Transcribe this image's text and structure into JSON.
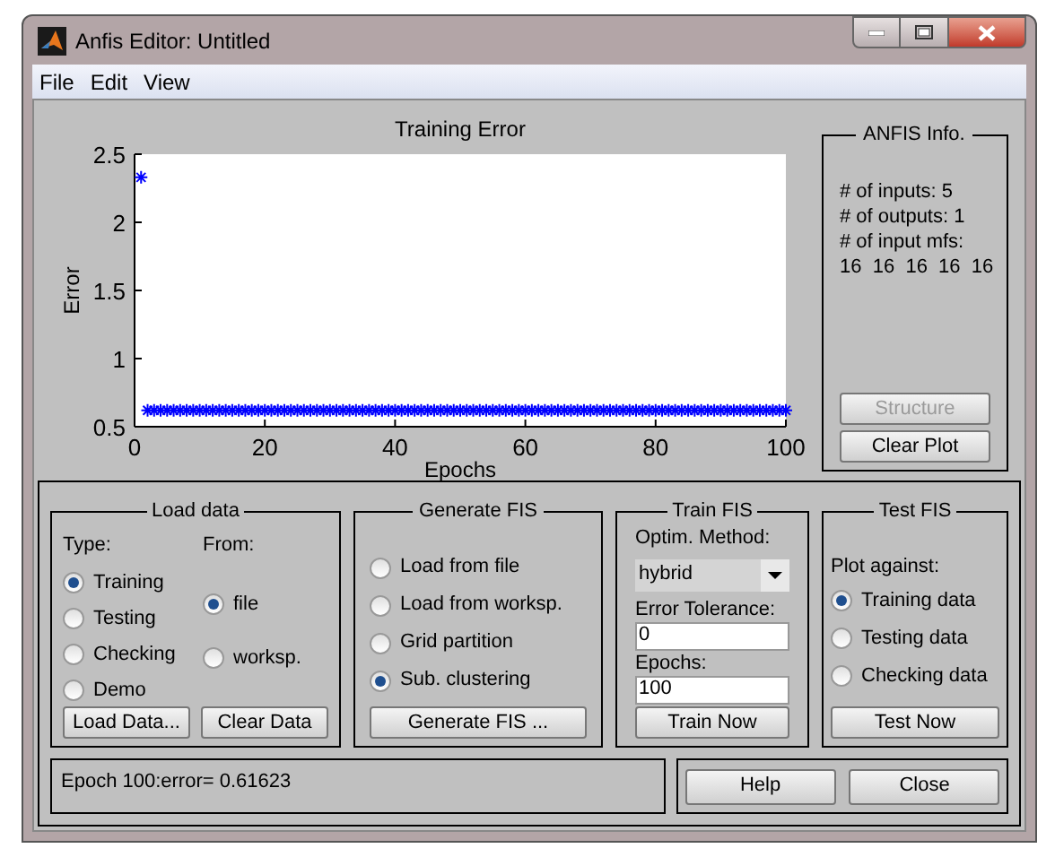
{
  "window": {
    "title": "Anfis Editor: Untitled",
    "menu": [
      "File",
      "Edit",
      "View"
    ]
  },
  "plot": {
    "chart_data": {
      "type": "scatter",
      "title": "Training Error",
      "xlabel": "Epochs",
      "ylabel": "Error",
      "xlim": [
        0,
        100
      ],
      "ylim": [
        0.5,
        2.5
      ],
      "xticks": [
        0,
        20,
        40,
        60,
        80,
        100
      ],
      "yticks": [
        {
          "value": 0.5,
          "label": "0.5"
        },
        1,
        {
          "value": 1.5,
          "label": "1.5"
        },
        2,
        {
          "value": 2.5,
          "label": "2.5"
        }
      ],
      "x": [
        1,
        2,
        3,
        4,
        5,
        6,
        7,
        8,
        9,
        10,
        11,
        12,
        13,
        14,
        15,
        16,
        17,
        18,
        19,
        20,
        21,
        22,
        23,
        24,
        25,
        26,
        27,
        28,
        29,
        30,
        31,
        32,
        33,
        34,
        35,
        36,
        37,
        38,
        39,
        40,
        41,
        42,
        43,
        44,
        45,
        46,
        47,
        48,
        49,
        50,
        51,
        52,
        53,
        54,
        55,
        56,
        57,
        58,
        59,
        60,
        61,
        62,
        63,
        64,
        65,
        66,
        67,
        68,
        69,
        70,
        71,
        72,
        73,
        74,
        75,
        76,
        77,
        78,
        79,
        80,
        81,
        82,
        83,
        84,
        85,
        86,
        87,
        88,
        89,
        90,
        91,
        92,
        93,
        94,
        95,
        96,
        97,
        98,
        99,
        100
      ],
      "series": [
        {
          "color": "#0000ff",
          "values": [
            2.33,
            0.62,
            0.62,
            0.62,
            0.62,
            0.62,
            0.62,
            0.62,
            0.62,
            0.62,
            0.62,
            0.62,
            0.62,
            0.62,
            0.62,
            0.62,
            0.62,
            0.62,
            0.62,
            0.62,
            0.62,
            0.62,
            0.62,
            0.62,
            0.62,
            0.62,
            0.62,
            0.62,
            0.62,
            0.62,
            0.62,
            0.62,
            0.62,
            0.62,
            0.62,
            0.62,
            0.62,
            0.62,
            0.62,
            0.62,
            0.62,
            0.62,
            0.62,
            0.62,
            0.62,
            0.62,
            0.62,
            0.62,
            0.62,
            0.62,
            0.62,
            0.62,
            0.62,
            0.62,
            0.62,
            0.62,
            0.62,
            0.62,
            0.62,
            0.62,
            0.62,
            0.62,
            0.62,
            0.62,
            0.62,
            0.62,
            0.62,
            0.62,
            0.62,
            0.62,
            0.62,
            0.62,
            0.62,
            0.62,
            0.62,
            0.62,
            0.62,
            0.62,
            0.62,
            0.62,
            0.62,
            0.62,
            0.62,
            0.62,
            0.62,
            0.62,
            0.62,
            0.62,
            0.62,
            0.62,
            0.62,
            0.62,
            0.62,
            0.62,
            0.62,
            0.62,
            0.62,
            0.62,
            0.62,
            0.62
          ]
        }
      ]
    }
  },
  "anfis_info": {
    "title": "ANFIS Info.",
    "lines": [
      "# of inputs: 5",
      "# of outputs: 1",
      "# of input mfs:",
      "16  16  16  16  16"
    ],
    "buttons": [
      {
        "label": "Structure",
        "disabled": true
      },
      {
        "label": "Clear Plot",
        "disabled": false
      }
    ]
  },
  "load_data": {
    "title": "Load data",
    "type_label": "Type:",
    "from_label": "From:",
    "type_options": [
      {
        "label": "Training",
        "selected": true
      },
      {
        "label": "Testing",
        "selected": false
      },
      {
        "label": "Checking",
        "selected": false
      },
      {
        "label": "Demo",
        "selected": false
      }
    ],
    "from_options": [
      {
        "label": "file",
        "selected": true
      },
      {
        "label": "worksp.",
        "selected": false
      }
    ],
    "buttons": [
      "Load Data...",
      "Clear Data"
    ]
  },
  "generate_fis": {
    "title": "Generate FIS",
    "options": [
      {
        "label": "Load from file",
        "selected": false
      },
      {
        "label": "Load from worksp.",
        "selected": false
      },
      {
        "label": "Grid partition",
        "selected": false
      },
      {
        "label": "Sub. clustering",
        "selected": true
      }
    ],
    "button": "Generate FIS ..."
  },
  "train_fis": {
    "title": "Train FIS",
    "method_label": "Optim. Method:",
    "method": "hybrid",
    "tolerance_label": "Error Tolerance:",
    "tolerance": "0",
    "epochs_label": "Epochs:",
    "epochs": "100",
    "button": "Train Now"
  },
  "test_fis": {
    "title": "Test FIS",
    "plot_label": "Plot against:",
    "options": [
      {
        "label": "Training data",
        "selected": true
      },
      {
        "label": "Testing data",
        "selected": false
      },
      {
        "label": "Checking data",
        "selected": false
      }
    ],
    "button": "Test Now"
  },
  "status": "Epoch 100:error= 0.61623",
  "buttons": [
    "Help",
    "Close"
  ]
}
